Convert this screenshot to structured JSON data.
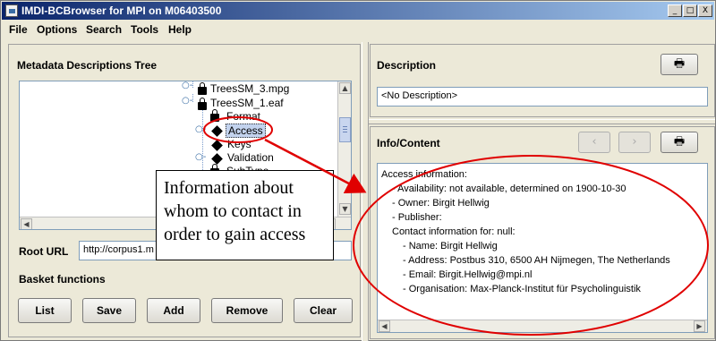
{
  "window": {
    "title": "IMDI-BCBrowser for MPI on M06403500",
    "controls": [
      "_",
      "□",
      "X"
    ]
  },
  "menu": [
    "File",
    "Options",
    "Search",
    "Tools",
    "Help"
  ],
  "tree_panel": {
    "title": "Metadata Descriptions Tree",
    "nodes": [
      "TreesSM_3.mpg",
      "TreesSM_1.eaf",
      "Format",
      "Access",
      "Keys",
      "Validation",
      "SubType"
    ]
  },
  "root_url": {
    "label": "Root URL",
    "value": "http://corpus1.m"
  },
  "basket": {
    "title": "Basket functions",
    "buttons": [
      "List",
      "Save",
      "Add",
      "Remove",
      "Clear"
    ]
  },
  "description": {
    "title": "Description",
    "value": "<No Description>",
    "print_icon": "printer-icon"
  },
  "info": {
    "title": "Info/Content",
    "lines": [
      "Access information:",
      "- Availability: not available, determined on 1900-10-30",
      "- Owner: Birgit Hellwig",
      "- Publisher:",
      "Contact information for: null:",
      "- Name: Birgit Hellwig",
      "- Address: Postbus 310, 6500 AH Nijmegen, The Netherlands",
      "- Email: Birgit.Hellwig@mpi.nl",
      "- Organisation: Max-Planck-Institut für Psycholinguistik"
    ],
    "nav_back": "‹",
    "nav_forward": "›",
    "print_icon": "printer-icon"
  },
  "callout": {
    "lines": [
      "Information about",
      "whom to contact in",
      "order to gain access"
    ]
  },
  "colors": {
    "annotation": "#e00000",
    "selection": "#c3d3ee",
    "titlebar": "#0a246a"
  }
}
